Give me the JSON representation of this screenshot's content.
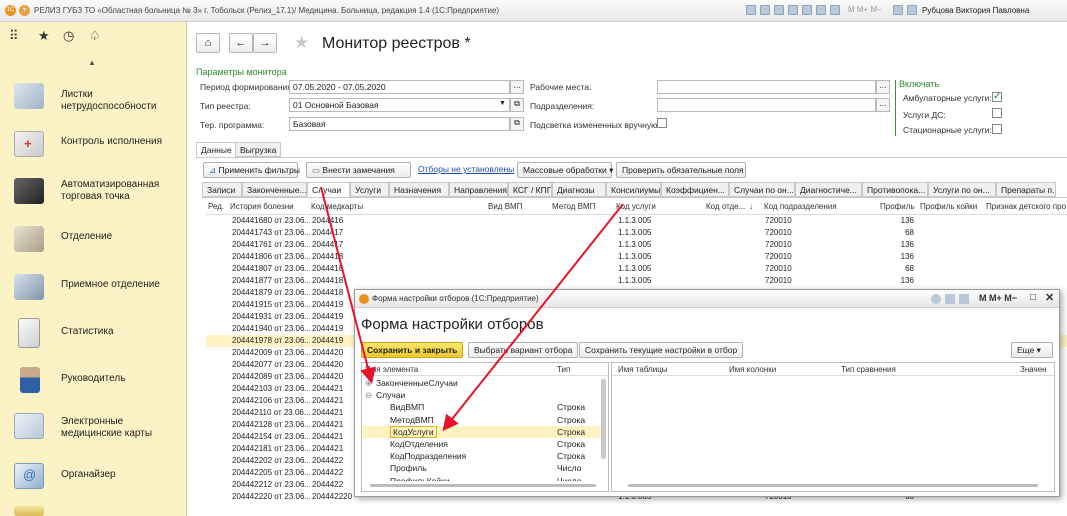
{
  "window": {
    "title": "РЕЛИЗ ГУБЗ ТО «Областная больница № 3» г. Тобольск (Релиз_17.1)/ Медицина. Больница, редакция 1.4  (1С:Предприятие)",
    "user": "Рубцова Виктория Павловна"
  },
  "sidebar": {
    "items": [
      {
        "label": "Листки нетрудоспособности"
      },
      {
        "label": "Контроль исполнения"
      },
      {
        "label": "Автоматизированная торговая точка"
      },
      {
        "label": "Отделение"
      },
      {
        "label": "Приемное отделение"
      },
      {
        "label": "Статистика"
      },
      {
        "label": "Руководитель"
      },
      {
        "label": "Электронные медицинские карты"
      },
      {
        "label": "Органайзер"
      }
    ]
  },
  "page": {
    "title": "Монитор реестров *"
  },
  "params": {
    "header": "Параметры монитора",
    "period_label": "Период формирования:",
    "period_value": "07.05.2020 - 07.05.2020",
    "registry_label": "Тип реестра:",
    "registry_value": "01 Основной Базовая",
    "territory_label": "Тер. программа:",
    "territory_value": "Базовая",
    "workplaces_label": "Рабочие места:",
    "departments_label": "Подразделения:",
    "highlight_label": "Подсветка измененных вручную:",
    "include_header": "Включать",
    "ambulatory_label": "Амбулаторные услуги:",
    "ds_label": "Услуги ДС:",
    "stationary_label": "Стационарные услуги:"
  },
  "tabs": [
    "Данные",
    "Выгрузка"
  ],
  "toolbar": {
    "apply_filters": "Применить фильтры",
    "add_remarks": "Внести замечания",
    "no_filters": "Отборы не установлены",
    "mass_processing": "Массовые обработки",
    "check_fields": "Проверить обязательные поля"
  },
  "subtabs": [
    "Записи",
    "Законченные...",
    "Случаи",
    "Услуги",
    "Назначения",
    "Направления",
    "КСГ / КПГ",
    "Диагнозы",
    "Консилиумы",
    "Коэффициен...",
    "Случаи по он...",
    "Диагностиче...",
    "Противопока...",
    "Услуги по он...",
    "Препараты п..."
  ],
  "grid": {
    "headers": [
      "Ред.",
      "История болезни",
      "Код медкарты",
      "Вид ВМП",
      "Метод ВМП",
      "Код услуги",
      "Код отде...",
      "Код подразделения",
      "Профиль",
      "Профиль койки",
      "Признак детского про"
    ],
    "rows": [
      {
        "hist": "204441680 от 23.06...",
        "card": "2044416",
        "svc": "1.1.3.005",
        "dep": "720010",
        "prof": "136"
      },
      {
        "hist": "204441743 от 23.06...",
        "card": "2044417",
        "svc": "1.1.3.005",
        "dep": "720010",
        "prof": "68"
      },
      {
        "hist": "204441761 от 23.06...",
        "card": "2044417",
        "svc": "1.1.3.005",
        "dep": "720010",
        "prof": "136"
      },
      {
        "hist": "204441806 от 23.06...",
        "card": "2044418",
        "svc": "1.1.3.005",
        "dep": "720010",
        "prof": "136"
      },
      {
        "hist": "204441807 от 23.06...",
        "card": "2044418",
        "svc": "1.1.3.005",
        "dep": "720010",
        "prof": "68"
      },
      {
        "hist": "204441877 от 23.06...",
        "card": "2044418",
        "svc": "1.1.3.005",
        "dep": "720010",
        "prof": "136"
      },
      {
        "hist": "204441879 от 23.06...",
        "card": "2044418",
        "svc": "",
        "dep": "",
        "prof": ""
      },
      {
        "hist": "204441915 от 23.06...",
        "card": "2044419",
        "svc": "",
        "dep": "",
        "prof": ""
      },
      {
        "hist": "204441931 от 23.06...",
        "card": "2044419",
        "svc": "",
        "dep": "",
        "prof": ""
      },
      {
        "hist": "204441940 от 23.06...",
        "card": "2044419",
        "svc": "",
        "dep": "",
        "prof": ""
      },
      {
        "hist": "204441978 от 23.06...",
        "card": "2044419",
        "svc": "",
        "dep": "",
        "prof": ""
      },
      {
        "hist": "204442009 от 23.06...",
        "card": "2044420",
        "svc": "",
        "dep": "",
        "prof": ""
      },
      {
        "hist": "204442077 от 23.06...",
        "card": "2044420",
        "svc": "",
        "dep": "",
        "prof": ""
      },
      {
        "hist": "204442089 от 23.06...",
        "card": "2044420",
        "svc": "",
        "dep": "",
        "prof": ""
      },
      {
        "hist": "204442103 от 23.06...",
        "card": "2044421",
        "svc": "",
        "dep": "",
        "prof": ""
      },
      {
        "hist": "204442106 от 23.06...",
        "card": "2044421",
        "svc": "",
        "dep": "",
        "prof": ""
      },
      {
        "hist": "204442110 от 23.06...",
        "card": "2044421",
        "svc": "",
        "dep": "",
        "prof": ""
      },
      {
        "hist": "204442128 от 23.06...",
        "card": "2044421",
        "svc": "",
        "dep": "",
        "prof": ""
      },
      {
        "hist": "204442154 от 23.06...",
        "card": "2044421",
        "svc": "",
        "dep": "",
        "prof": ""
      },
      {
        "hist": "204442181 от 23.06...",
        "card": "2044421",
        "svc": "",
        "dep": "",
        "prof": ""
      },
      {
        "hist": "204442202 от 23.06...",
        "card": "2044422",
        "svc": "",
        "dep": "",
        "prof": ""
      },
      {
        "hist": "204442205 от 23.06...",
        "card": "2044422",
        "svc": "",
        "dep": "",
        "prof": ""
      },
      {
        "hist": "204442212 от 23.06...",
        "card": "2044422",
        "svc": "",
        "dep": "",
        "prof": ""
      },
      {
        "hist": "204442220 от 23.06...",
        "card": "204442220",
        "svc": "1.1.3.005",
        "dep": "720010",
        "prof": "68"
      }
    ]
  },
  "modal": {
    "window_title": "Форма настройки отборов  (1С:Предприятие)",
    "title": "Форма настройки отборов",
    "save_close": "Сохранить и закрыть",
    "choose_variant": "Выбрать вариант отбора",
    "save_current": "Сохранить текущие настройки в отбор",
    "more": "Еще",
    "left_headers": [
      "Имя элемента",
      "Тип"
    ],
    "right_headers": [
      "Имя таблицы",
      "Имя колонки",
      "Тип сравнения",
      "Значен"
    ],
    "tree": [
      {
        "name": "ЗаконченныеСлучаи",
        "type": "",
        "level": 0
      },
      {
        "name": "Случаи",
        "type": "",
        "level": 0
      },
      {
        "name": "ВидВМП",
        "type": "Строка",
        "level": 1
      },
      {
        "name": "МетодВМП",
        "type": "Строка",
        "level": 1
      },
      {
        "name": "КодУслуги",
        "type": "Строка",
        "level": 1
      },
      {
        "name": "КодОтделения",
        "type": "Строка",
        "level": 1
      },
      {
        "name": "КодПодразделения",
        "type": "Строка",
        "level": 1
      },
      {
        "name": "Профиль",
        "type": "Число",
        "level": 1
      },
      {
        "name": "ПрофильКойки",
        "type": "Число",
        "level": 1
      }
    ],
    "window_controls": "M M+ M−"
  },
  "colors": {
    "sidebar_bg": "#fbf3c6",
    "accent_green": "#2e8b2e",
    "highlight_row": "#fff3c4",
    "arrow_red": "#e8132b",
    "save_btn": "#f5d33a"
  }
}
